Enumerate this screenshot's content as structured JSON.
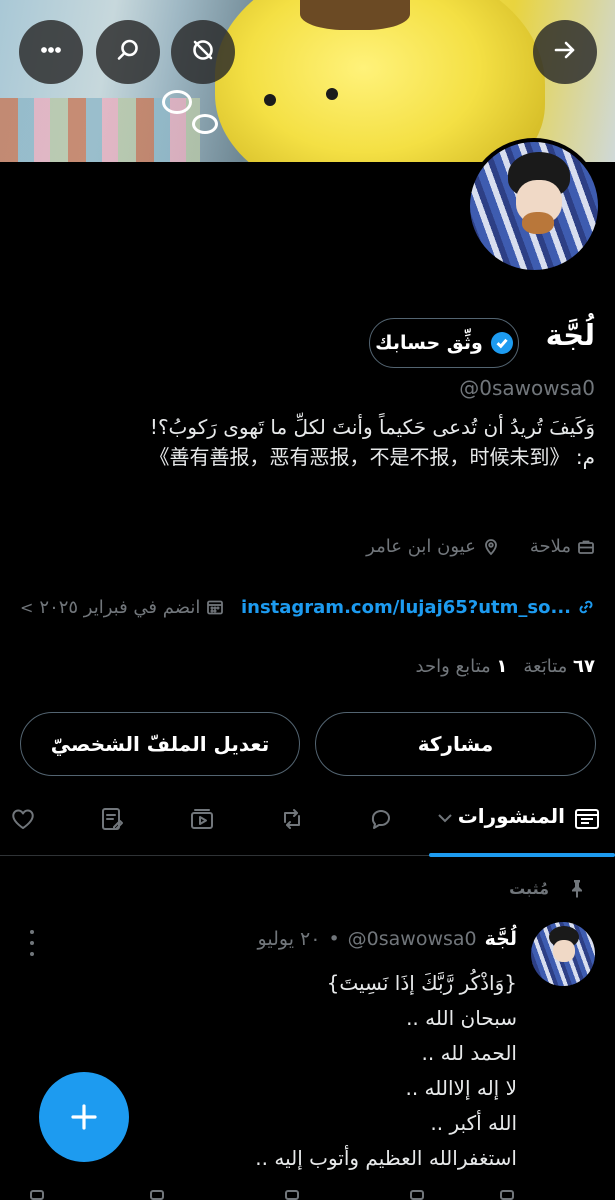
{
  "header": {
    "more_icon": "more-horizontal-icon",
    "search_icon": "search-icon",
    "no_notifications_icon": "bell-off-icon",
    "back_icon": "arrow-right-icon"
  },
  "profile": {
    "display_name": "لُجَّة",
    "handle": "@0sawowsa0",
    "verify_button": "وثِّق حسابك",
    "bio_line1": "وَكَيفَ تُريدُ أن تُدعى حَكيماً وأنتَ لكلِّ ما تَهوى رَكوبُ؟!",
    "bio_line2": "م: 《善有善报，恶有恶报，不是不报，时候未到》",
    "profession": "ملاحة",
    "location": "عيون ابن عامر",
    "link": "instagram.com/lujaj65?utm_so...",
    "joined": "انضم في فبراير ٢٠٢٥",
    "following_count": "٦٧",
    "following_label": "متابَعة",
    "followers_count": "١",
    "followers_label": "متابع واحد"
  },
  "actions": {
    "share": "مشاركة",
    "edit_profile": "تعديل الملفّ الشخصيّ"
  },
  "tabs": {
    "posts": "المنشورات"
  },
  "pinned_post": {
    "pinned_label": "مُثبت",
    "author": "لُجَّة",
    "handle": "@0sawowsa0",
    "separator": "•",
    "date": "٢٠ يوليو",
    "lines": [
      "{وَاذْكُر رَّبَّكَ إذَا نَسِيتَ}",
      "سبحان الله ..",
      "الحمد لله ..",
      "لا إله إلاالله ..",
      "الله أكبر ..",
      "استغفرالله العظيم وأتوب إليه .."
    ]
  },
  "colors": {
    "accent": "#1d9bf0",
    "background": "#000000",
    "muted": "#71767b"
  }
}
